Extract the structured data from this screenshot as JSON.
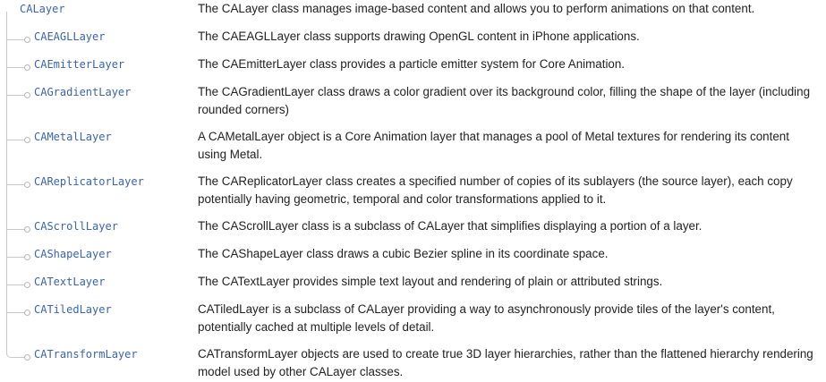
{
  "root": {
    "name": "CALayer",
    "description": "The CALayer class manages image-based content and allows you to perform animations on that content."
  },
  "children": [
    {
      "name": "CAEAGLLayer",
      "description": "The CAEAGLLayer class supports drawing OpenGL content in iPhone applications."
    },
    {
      "name": "CAEmitterLayer",
      "description": "The CAEmitterLayer class provides a particle emitter system for Core Animation."
    },
    {
      "name": "CAGradientLayer",
      "description": "The CAGradientLayer class draws a color gradient over its background color, filling the shape of the layer (including rounded corners)"
    },
    {
      "name": "CAMetalLayer",
      "description": "A CAMetalLayer object is a Core Animation layer that manages a pool of Metal textures for rendering its content using Metal."
    },
    {
      "name": "CAReplicatorLayer",
      "description": "The CAReplicatorLayer class creates a specified number of copies of its sublayers (the source layer), each copy potentially having geometric, temporal and color transformations applied to it."
    },
    {
      "name": "CAScrollLayer",
      "description": "The CAScrollLayer class is a subclass of CALayer that simplifies displaying a portion of a layer."
    },
    {
      "name": "CAShapeLayer",
      "description": "The CAShapeLayer class draws a cubic Bezier spline in its coordinate space."
    },
    {
      "name": "CATextLayer",
      "description": "The CATextLayer provides simple text layout and rendering of plain or attributed strings."
    },
    {
      "name": "CATiledLayer",
      "description": "CATiledLayer is a subclass of CALayer providing a way to asynchronously provide tiles of the layer's content, potentially cached at multiple levels of detail."
    },
    {
      "name": "CATransformLayer",
      "description": "CATransformLayer objects are used to create true 3D layer hierarchies, rather than the flattened hierarchy rendering model used by other CALayer classes."
    }
  ],
  "colors": {
    "link": "#3a64b0",
    "text": "#222222",
    "tree_line": "#c9c9c9"
  }
}
